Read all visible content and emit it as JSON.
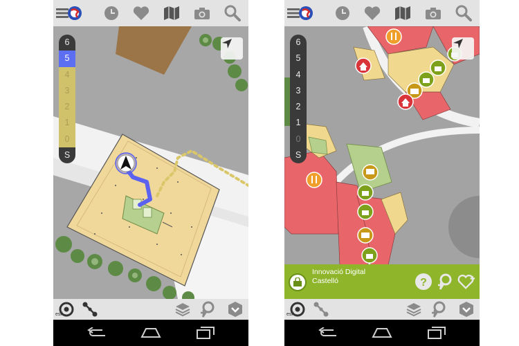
{
  "left_screen": {
    "floors": [
      "6",
      "5",
      "4",
      "3",
      "2",
      "1",
      "0",
      "S"
    ],
    "active_floor": "5",
    "selected_range": [
      "4",
      "3",
      "2",
      "1",
      "0"
    ]
  },
  "right_screen": {
    "floors": [
      "6",
      "5",
      "4",
      "3",
      "2",
      "1",
      "0",
      "S"
    ],
    "poi": {
      "line1": "Innovació Digital",
      "line2": "Castelló"
    }
  },
  "attribution": "esri",
  "colors": {
    "topbar": "#e3e3e3",
    "active_floor": "#5c6ef2",
    "range_floor": "#cfc26a",
    "poi_panel": "#8fb62b",
    "room_red": "#e8666a",
    "room_green": "#b5cf8d",
    "room_yellow": "#f0d98e",
    "icon_green": "#7da11a",
    "icon_orange": "#f0a02a",
    "icon_red": "#d9343a"
  },
  "icons": {
    "topbar": [
      "menu-icon",
      "app-logo-icon",
      "clock-icon",
      "heart-icon",
      "map-icon",
      "camera-icon",
      "search-icon"
    ],
    "bottombar": [
      "target-icon",
      "route-icon",
      "layers-icon",
      "add-location-icon",
      "chevron-down-icon"
    ],
    "navbar": [
      "back-icon",
      "home-icon",
      "recent-apps-icon"
    ],
    "poi_actions": [
      "help-icon",
      "add-location-icon",
      "favorite-add-icon"
    ]
  }
}
